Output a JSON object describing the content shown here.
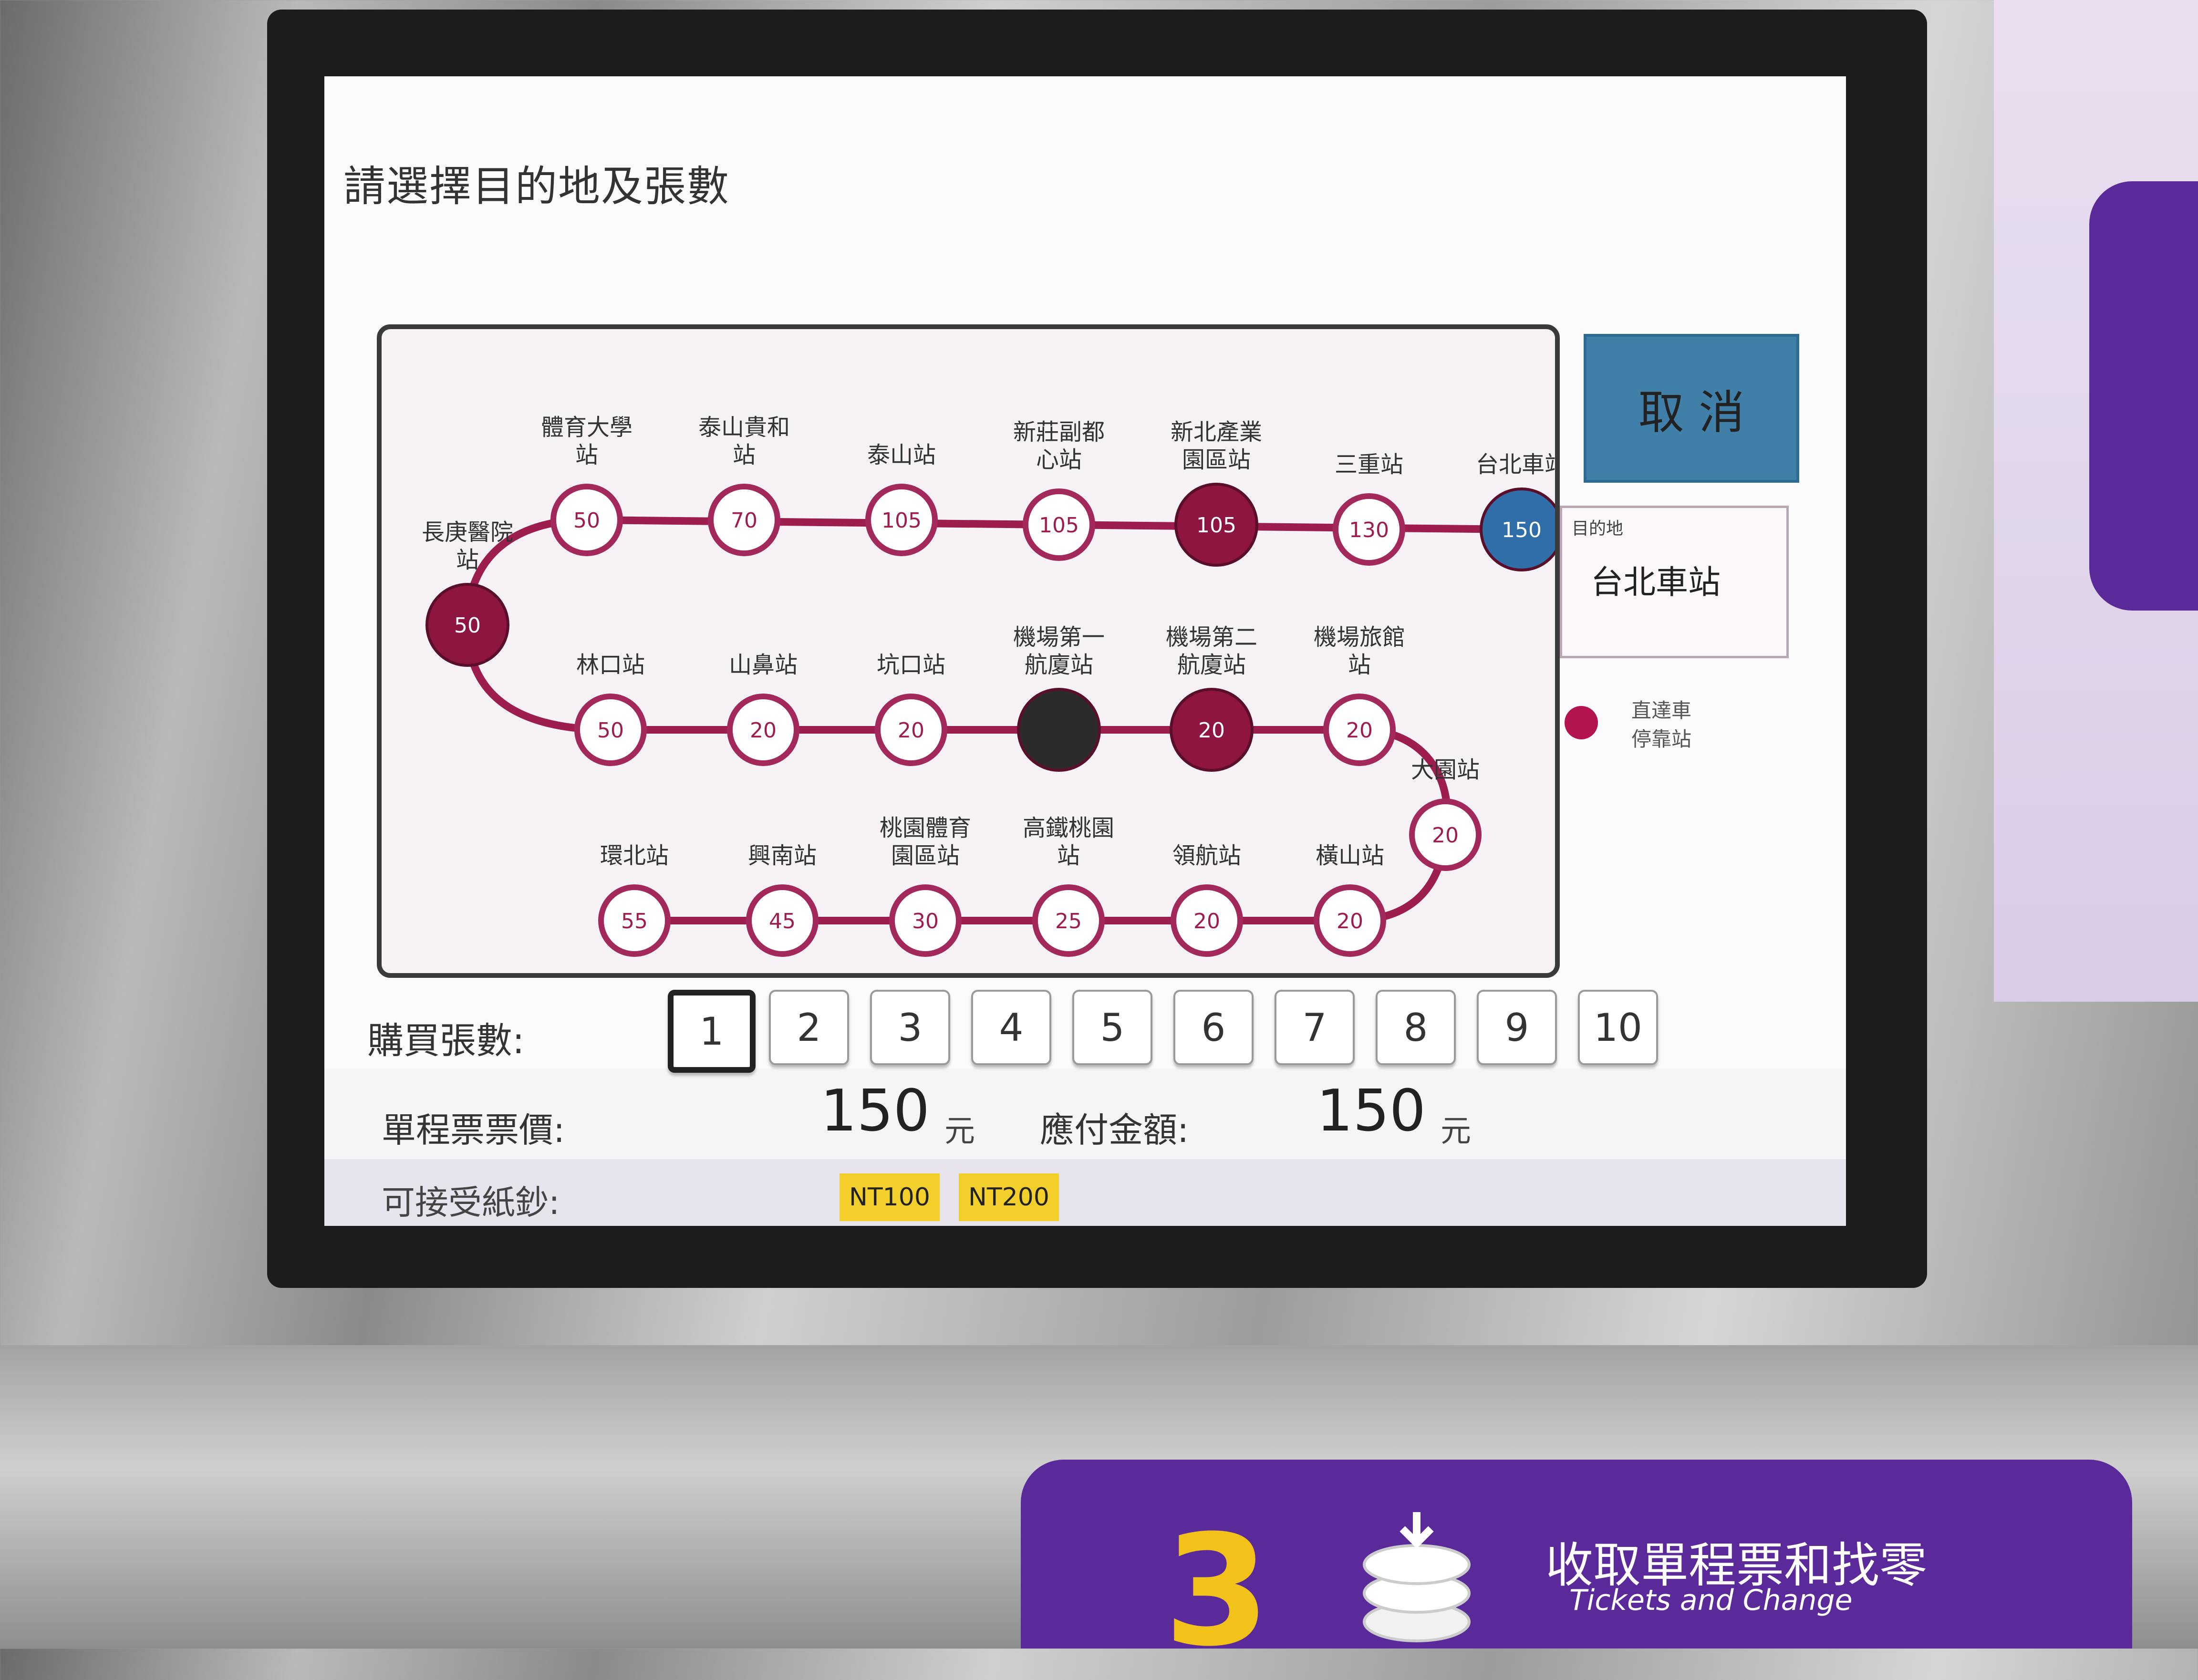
{
  "screen": {
    "title": "請選擇目的地及張數",
    "cancel_label": "取 消",
    "destination": {
      "label": "目的地",
      "value": "台北車站"
    },
    "legend": {
      "label": "直達車\n停靠站",
      "color": "#b3134f"
    },
    "route": [
      {
        "name": "長庚醫院\n站",
        "fare": "50",
        "style": "express"
      },
      {
        "name": "體育大學\n站",
        "fare": "50",
        "style": "normal"
      },
      {
        "name": "泰山貴和\n站",
        "fare": "70",
        "style": "normal"
      },
      {
        "name": "泰山站",
        "fare": "105",
        "style": "normal"
      },
      {
        "name": "新莊副都\n心站",
        "fare": "105",
        "style": "normal"
      },
      {
        "name": "新北產業\n園區站",
        "fare": "105",
        "style": "express"
      },
      {
        "name": "三重站",
        "fare": "130",
        "style": "normal"
      },
      {
        "name": "台北車站",
        "fare": "150",
        "style": "selected"
      },
      {
        "name": "林口站",
        "fare": "50",
        "style": "normal"
      },
      {
        "name": "山鼻站",
        "fare": "20",
        "style": "normal"
      },
      {
        "name": "坑口站",
        "fare": "20",
        "style": "normal"
      },
      {
        "name": "機場第一\n航廈站",
        "fare": "",
        "style": "current"
      },
      {
        "name": "機場第二\n航廈站",
        "fare": "20",
        "style": "express"
      },
      {
        "name": "機場旅館\n站",
        "fare": "20",
        "style": "normal"
      },
      {
        "name": "大園站",
        "fare": "20",
        "style": "normal"
      },
      {
        "name": "橫山站",
        "fare": "20",
        "style": "normal"
      },
      {
        "name": "領航站",
        "fare": "20",
        "style": "normal"
      },
      {
        "name": "高鐵桃園\n站",
        "fare": "25",
        "style": "normal"
      },
      {
        "name": "桃園體育\n園區站",
        "fare": "30",
        "style": "normal"
      },
      {
        "name": "興南站",
        "fare": "45",
        "style": "normal"
      },
      {
        "name": "環北站",
        "fare": "55",
        "style": "normal"
      }
    ],
    "quantity": {
      "label": "購買張數:",
      "options": [
        "1",
        "2",
        "3",
        "4",
        "5",
        "6",
        "7",
        "8",
        "9",
        "10"
      ],
      "selected": "1"
    },
    "single_fare": {
      "label": "單程票票價:",
      "value": "150",
      "unit": "元"
    },
    "amount_due": {
      "label": "應付金額:",
      "value": "150",
      "unit": "元"
    },
    "accepted_notes": {
      "label": "可接受紙鈔:",
      "notes": [
        "NT100",
        "NT200"
      ]
    },
    "colors": {
      "line": "#9e1d4f",
      "normal_fill": "#ffffff",
      "express_fill": "#8e1540",
      "selected_fill": "#2f6ea8",
      "current_fill": "#2b2b2b",
      "note_badge": "#f2cf2b"
    }
  },
  "sign": {
    "step": "3",
    "text_zh": "收取單程票和找零",
    "text_en": "Tickets and Change"
  }
}
